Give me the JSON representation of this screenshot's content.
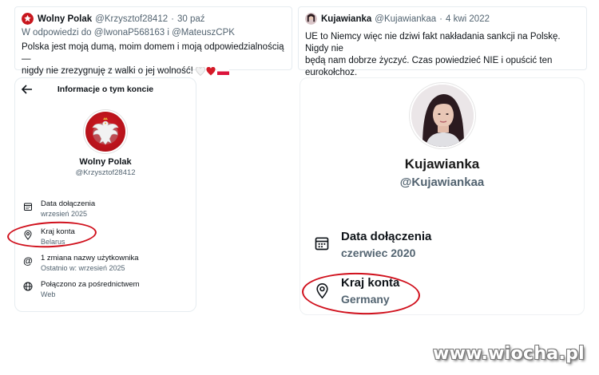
{
  "tweet_left": {
    "name": "Wolny Polak",
    "handle": "@Krzysztof28412",
    "separator": "·",
    "date": "30 paź",
    "reply_to": "W odpowiedzi do @IwonaP568163 i @MateuszCPK",
    "text_line1": "Polska jest moją dumą, moim domem i moją odpowiedzialnością —",
    "text_line2": "nigdy nie zrezygnuję z walki o jej wolność!"
  },
  "tweet_right": {
    "name": "Kujawianka",
    "handle": "@Kujawiankaa",
    "separator": "·",
    "date": "4 kwi 2022",
    "text_line1": "UE to Niemcy więc nie dziwi fakt nakładania sankcji na Polskę. Nigdy nie",
    "text_line2": "będą nam dobrze życzyć. Czas powiedzieć NIE i opuścić ten",
    "text_line3": "eurokołchoz."
  },
  "left_panel": {
    "header_title": "Informacje o tym koncie",
    "profile_name": "Wolny Polak",
    "profile_handle": "@Krzysztof28412",
    "rows": [
      {
        "label": "Data dołączenia",
        "value": "wrzesień 2025",
        "icon": "calendar-icon"
      },
      {
        "label": "Kraj konta",
        "value": "Belarus",
        "icon": "location-pin-icon"
      },
      {
        "label": "1 zmiana nazwy użytkownika",
        "value": "Ostatnio w: wrzesień 2025",
        "icon": "at-sign-icon"
      },
      {
        "label": "Połączono za pośrednictwem",
        "value": "Web",
        "icon": "globe-icon"
      }
    ]
  },
  "right_panel": {
    "profile_name": "Kujawianka",
    "profile_handle": "@Kujawiankaa",
    "rows": [
      {
        "label": "Data dołączenia",
        "value": "czerwiec 2020",
        "icon": "calendar-icon"
      },
      {
        "label": "Kraj konta",
        "value": "Germany",
        "icon": "location-pin-icon"
      }
    ]
  },
  "watermark": "www.wiocha.pl",
  "colors": {
    "highlight": "#d0101c",
    "muted": "#536471",
    "text": "#0f1419"
  }
}
